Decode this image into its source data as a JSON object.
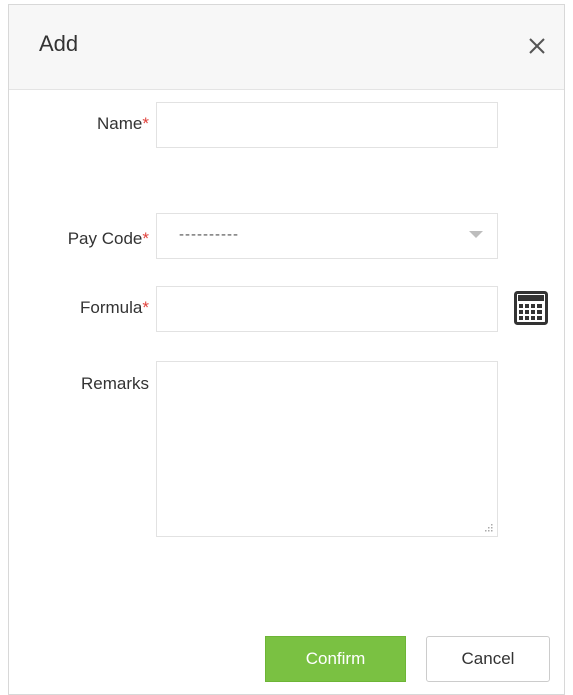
{
  "dialog": {
    "title": "Add",
    "close_icon": "close-icon"
  },
  "form": {
    "name": {
      "label": "Name",
      "required_mark": "*",
      "value": ""
    },
    "pay_code": {
      "label": "Pay Code",
      "required_mark": "*",
      "selected": "----------"
    },
    "formula": {
      "label": "Formula",
      "required_mark": "*",
      "value": "",
      "icon": "calculator-icon"
    },
    "remarks": {
      "label": "Remarks",
      "value": ""
    }
  },
  "actions": {
    "confirm_label": "Confirm",
    "cancel_label": "Cancel"
  },
  "colors": {
    "accent": "#7ac142",
    "required": "#e0403a"
  }
}
